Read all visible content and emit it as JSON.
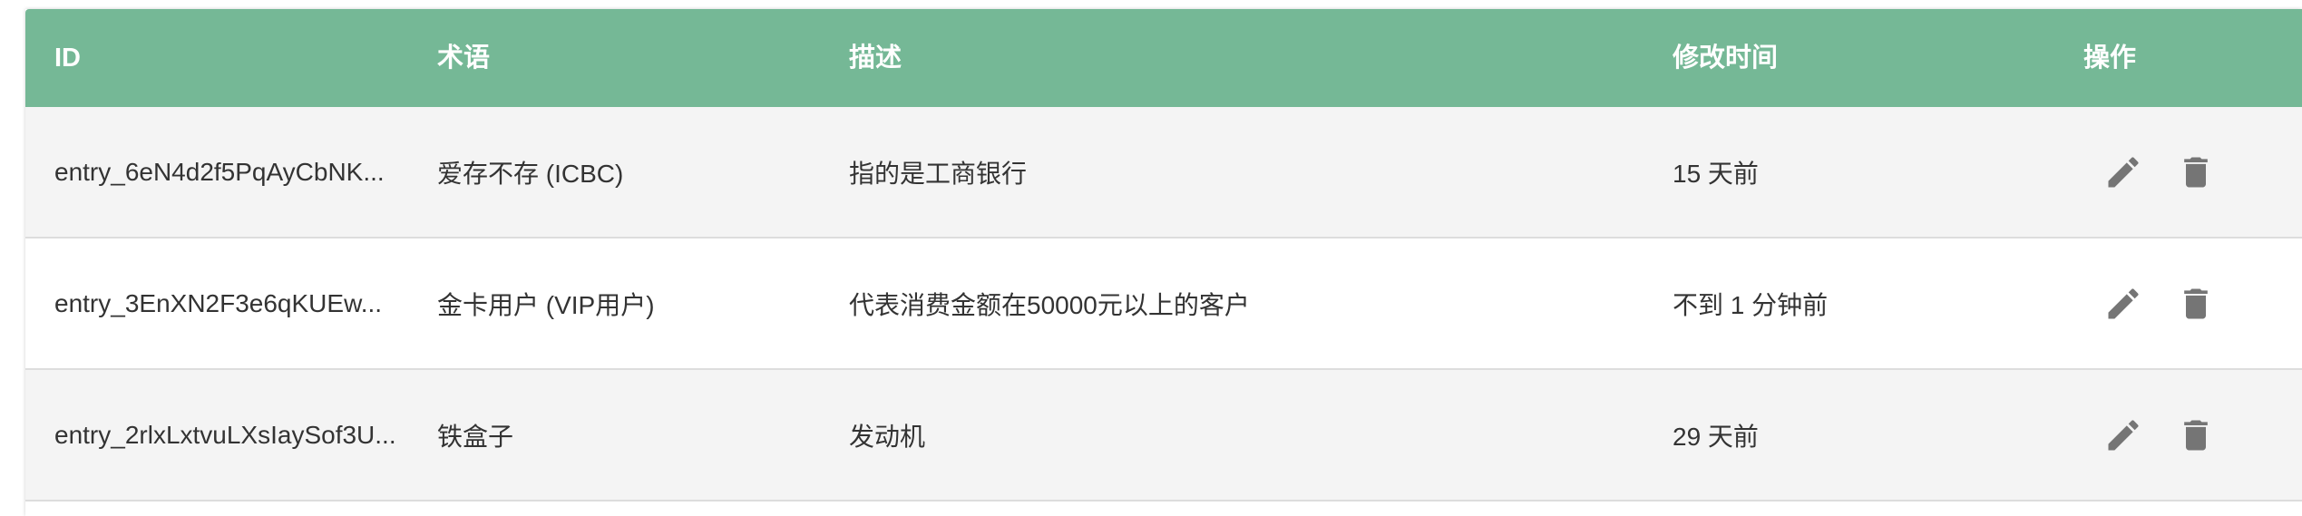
{
  "table": {
    "headers": {
      "id": "ID",
      "term": "术语",
      "description": "描述",
      "modified": "修改时间",
      "actions": "操作"
    },
    "rows": [
      {
        "id": "entry_6eN4d2f5PqAyCbNK...",
        "term": "爱存不存 (ICBC)",
        "description": "指的是工商银行",
        "modified": "15 天前"
      },
      {
        "id": "entry_3EnXN2F3e6qKUEw...",
        "term": "金卡用户 (VIP用户)",
        "description": "代表消费金额在50000元以上的客户",
        "modified": "不到 1 分钟前"
      },
      {
        "id": "entry_2rlxLxtvuLXsIaySof3U...",
        "term": "铁盒子",
        "description": "发动机",
        "modified": "29 天前"
      }
    ]
  },
  "icons": {
    "edit": "pencil-icon",
    "delete": "trash-icon"
  },
  "colors": {
    "header_bg": "#75b896",
    "row_stripe": "#f4f4f4",
    "icon": "#757575"
  }
}
